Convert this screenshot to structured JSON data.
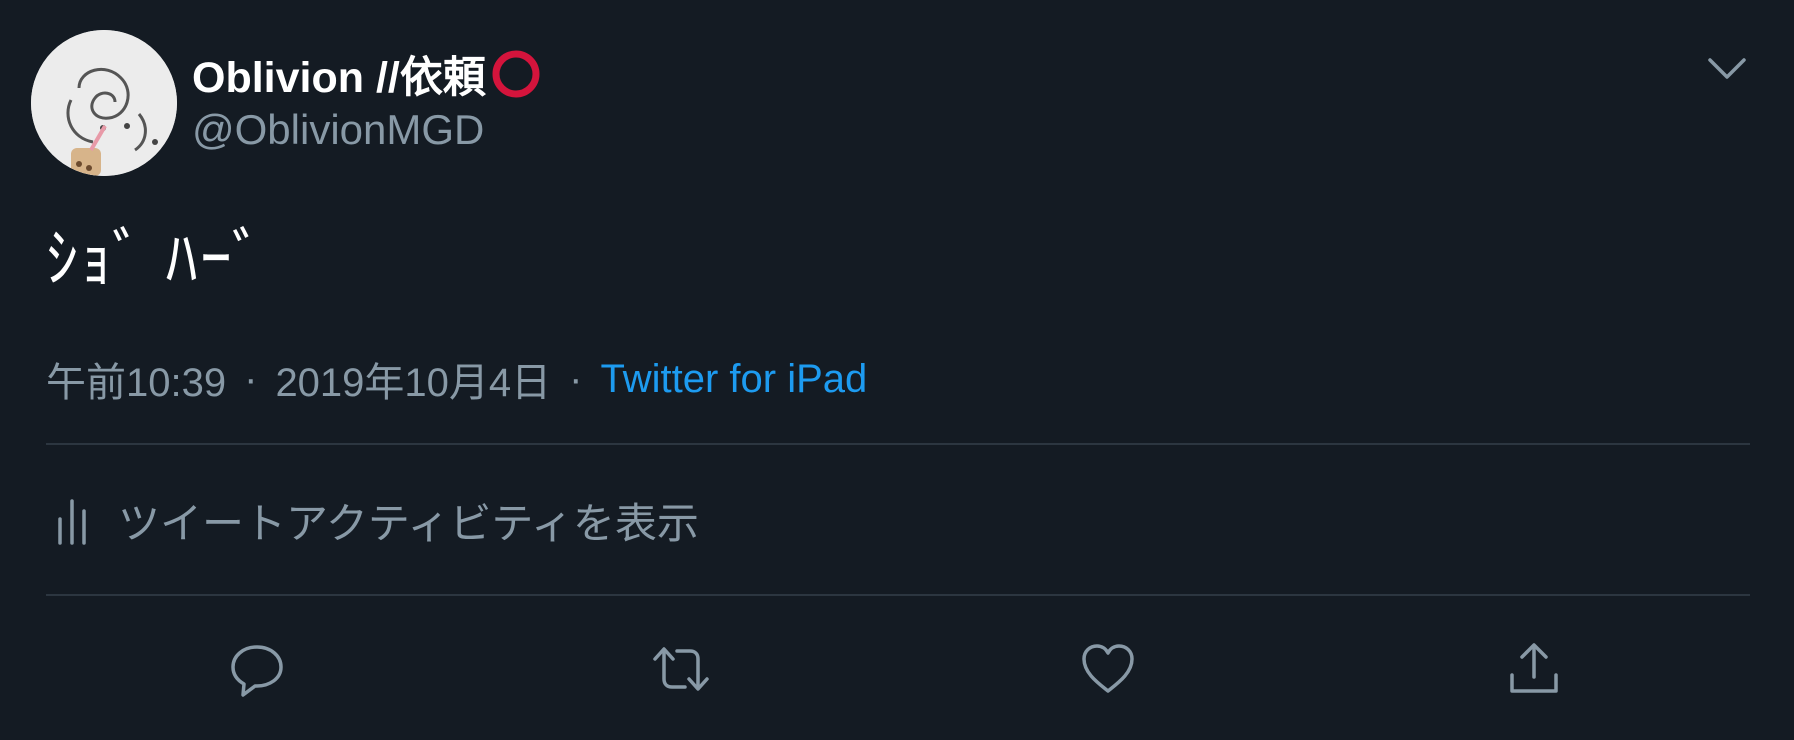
{
  "tweet": {
    "display_name": "Oblivion //依頼",
    "handle": "@OblivionMGD",
    "text": "ｼｮﾞ ﾊｰﾞ",
    "timestamp": "午前10:39",
    "date": "2019年10月4日",
    "separator": "·",
    "source": "Twitter for iPad",
    "activity_label": "ツイートアクティビティを表示"
  },
  "icons": {
    "avatar": "avatar-image",
    "name_badge": "red-circle-icon",
    "caret": "chevron-down-icon",
    "activity": "analytics-bars-icon",
    "reply": "reply-icon",
    "retweet": "retweet-icon",
    "like": "heart-icon",
    "share": "share-icon"
  },
  "colors": {
    "background": "#141b23",
    "primary_text": "#ffffff",
    "secondary_text": "#8899a6",
    "link": "#1d9bf0",
    "badge_red": "#d4143c",
    "divider": "#2c3640"
  }
}
